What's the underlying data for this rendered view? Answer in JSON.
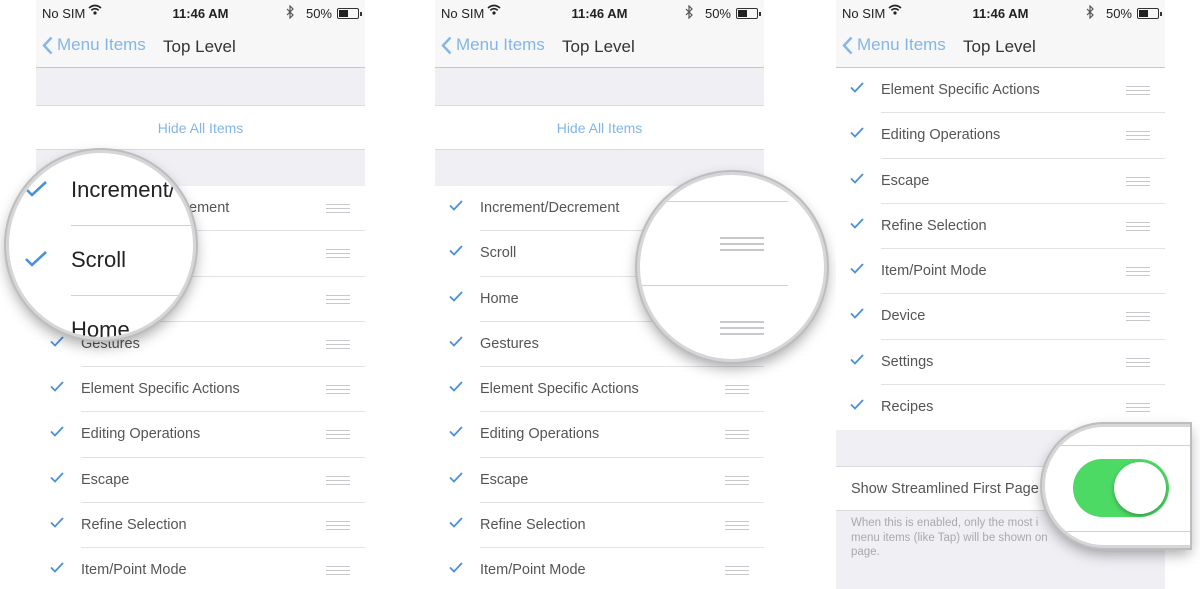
{
  "status": {
    "carrier": "No SIM",
    "time": "11:46 AM",
    "battery": "50%",
    "battery_level": 0.5
  },
  "nav": {
    "back_label": "Menu Items",
    "title": "Top Level"
  },
  "hide_all_label": "Hide All Items",
  "colors": {
    "accent": "#4a90d9",
    "link": "#82b6e8",
    "switch_on": "#4cd964"
  },
  "icons": {
    "back": "chevron-left-icon",
    "check": "checkmark-icon",
    "grip": "reorder-grip-icon",
    "wifi": "wifi-icon",
    "bluetooth": "bluetooth-icon",
    "battery": "battery-icon"
  },
  "items": [
    "Increment/Decrement",
    "Scroll",
    "Home",
    "Gestures",
    "Element Specific Actions",
    "Editing Operations",
    "Escape",
    "Refine Selection",
    "Item/Point Mode",
    "Device",
    "Settings",
    "Recipes"
  ],
  "visible_row1": "Gestures",
  "visible_row1_partial": "ement",
  "zoom1": {
    "line1": "Increment/",
    "line2": "Scroll",
    "line3": "Home"
  },
  "streamlined": {
    "label": "Show Streamlined First Page",
    "footnote": "When this is enabled, only the most i",
    "footnote2": "menu items (like Tap) will be shown on",
    "footnote3": "page.",
    "enabled": true
  }
}
